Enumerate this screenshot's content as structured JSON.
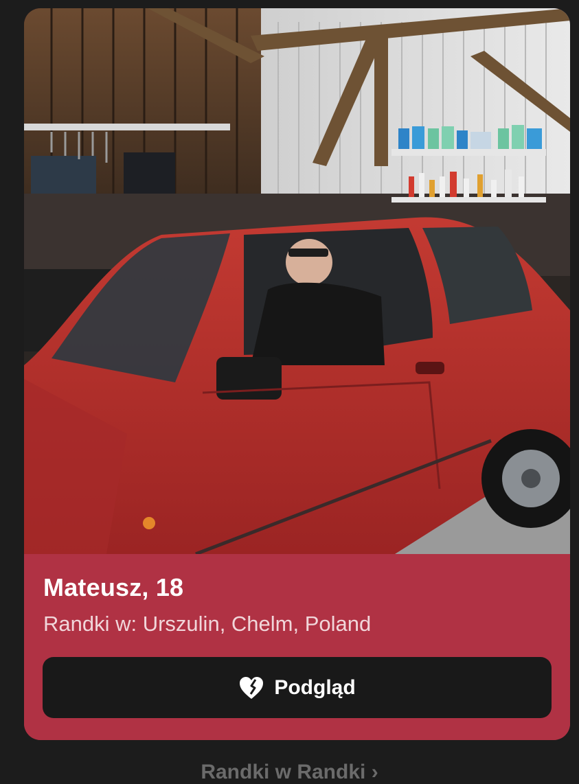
{
  "profile": {
    "name_age": "Mateusz, 18",
    "location": "Randki w: Urszulin, Chelm, Poland",
    "photo_alt": "Mateusz"
  },
  "actions": {
    "preview_label": "Podgląd",
    "preview_icon": "heart-icon"
  },
  "footer": {
    "link_label": "Randki w Randki ›"
  },
  "colors": {
    "page_background": "#1c1c1c",
    "card_background": "#b03244",
    "button_background": "#191919",
    "text_primary": "#ffffff"
  }
}
